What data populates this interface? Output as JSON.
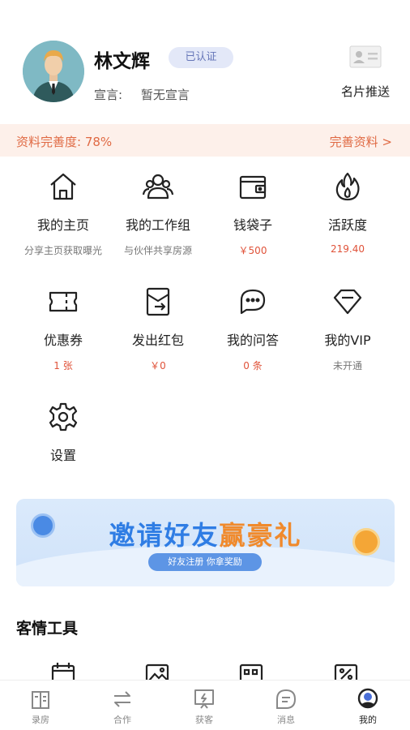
{
  "profile": {
    "name": "林文辉",
    "verify_badge": "已认证",
    "motto_label": "宣言:",
    "motto_value": "暂无宣言",
    "card_push_label": "名片推送"
  },
  "completeness": {
    "text": "资料完善度: 78%",
    "action": "完善资料 >"
  },
  "grid": [
    {
      "label": "我的主页",
      "sub": "分享主页获取曝光",
      "icon": "home-icon"
    },
    {
      "label": "我的工作组",
      "sub": "与伙伴共享房源",
      "icon": "group-icon"
    },
    {
      "label": "钱袋子",
      "sub": "￥500",
      "icon": "wallet-icon"
    },
    {
      "label": "活跃度",
      "sub": "219.40",
      "icon": "flame-icon"
    },
    {
      "label": "优惠券",
      "sub": "1 张",
      "icon": "coupon-icon"
    },
    {
      "label": "发出红包",
      "sub": "￥0",
      "icon": "red-packet-icon"
    },
    {
      "label": "我的问答",
      "sub": "0 条",
      "icon": "chat-icon"
    },
    {
      "label": "我的VIP",
      "sub": "未开通",
      "icon": "diamond-icon"
    },
    {
      "label": "设置",
      "sub": "",
      "icon": "gear-icon"
    }
  ],
  "banner": {
    "title_part1": "邀请好友",
    "title_part2": "赢豪礼",
    "pill": "好友注册 你拿奖励"
  },
  "section_title": "客情工具",
  "tabs": [
    {
      "label": "录房",
      "icon": "document-icon"
    },
    {
      "label": "合作",
      "icon": "swap-icon"
    },
    {
      "label": "获客",
      "icon": "presentation-icon"
    },
    {
      "label": "消息",
      "icon": "message-icon"
    },
    {
      "label": "我的",
      "icon": "user-icon"
    }
  ],
  "colors": {
    "accent_red": "#e0533a",
    "accent_orange": "#e06a44",
    "banner_blue": "#2f7de4",
    "banner_orange": "#f08a2c"
  }
}
